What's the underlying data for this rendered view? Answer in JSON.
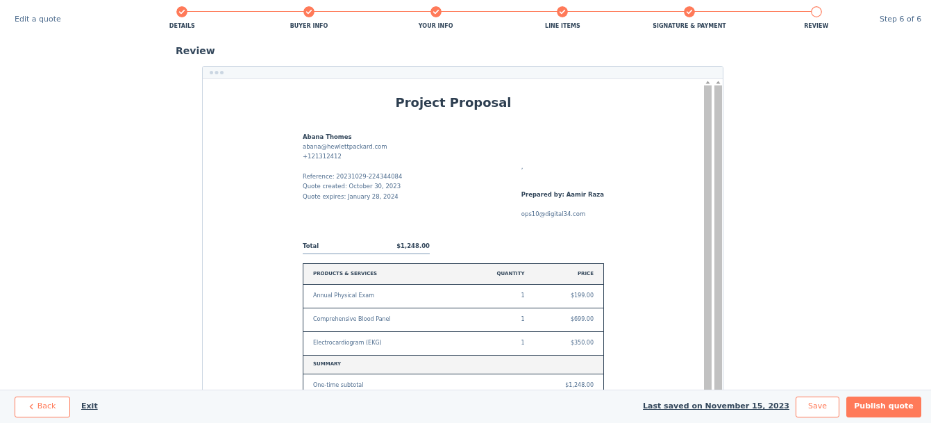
{
  "header": {
    "title": "Edit a quote",
    "step_counter": "Step 6 of 6"
  },
  "steps": [
    {
      "label": "DETAILS",
      "completed": true
    },
    {
      "label": "BUYER INFO",
      "completed": true
    },
    {
      "label": "YOUR INFO",
      "completed": true
    },
    {
      "label": "LINE ITEMS",
      "completed": true
    },
    {
      "label": "SIGNATURE & PAYMENT",
      "completed": true
    },
    {
      "label": "REVIEW",
      "completed": false
    }
  ],
  "page_title": "Review",
  "document": {
    "title": "Project Proposal",
    "buyer": {
      "name": "Abana Thomes",
      "email": "abana@hewlettpackard.com",
      "phone": "+121312412"
    },
    "meta": [
      "Reference: 20231029-224344084",
      "Quote created: October 30, 2023",
      "Quote expires: January 28, 2024"
    ],
    "seller": {
      "mark": ",",
      "prepared_by": "Prepared by: Aamir Raza",
      "email": "ops10@digital34.com"
    },
    "total": {
      "label": "Total",
      "value": "$1,248.00"
    },
    "table": {
      "columns": [
        "PRODUCTS & SERVICES",
        "QUANTITY",
        "PRICE"
      ],
      "rows": [
        {
          "name": "Annual Physical Exam",
          "quantity": "1",
          "price": "$199.00"
        },
        {
          "name": "Comprehensive Blood Panel",
          "quantity": "1",
          "price": "$699.00"
        },
        {
          "name": "Electrocardiogram (EKG)",
          "quantity": "1",
          "price": "$350.00"
        }
      ],
      "summary_heading": "SUMMARY",
      "summary_rows": [
        {
          "label": "One-time subtotal",
          "value": "$1,248.00"
        }
      ]
    }
  },
  "footer": {
    "back": "Back",
    "exit": "Exit",
    "last_saved": "Last saved on November 15, 2023",
    "save": "Save",
    "publish": "Publish quote"
  }
}
